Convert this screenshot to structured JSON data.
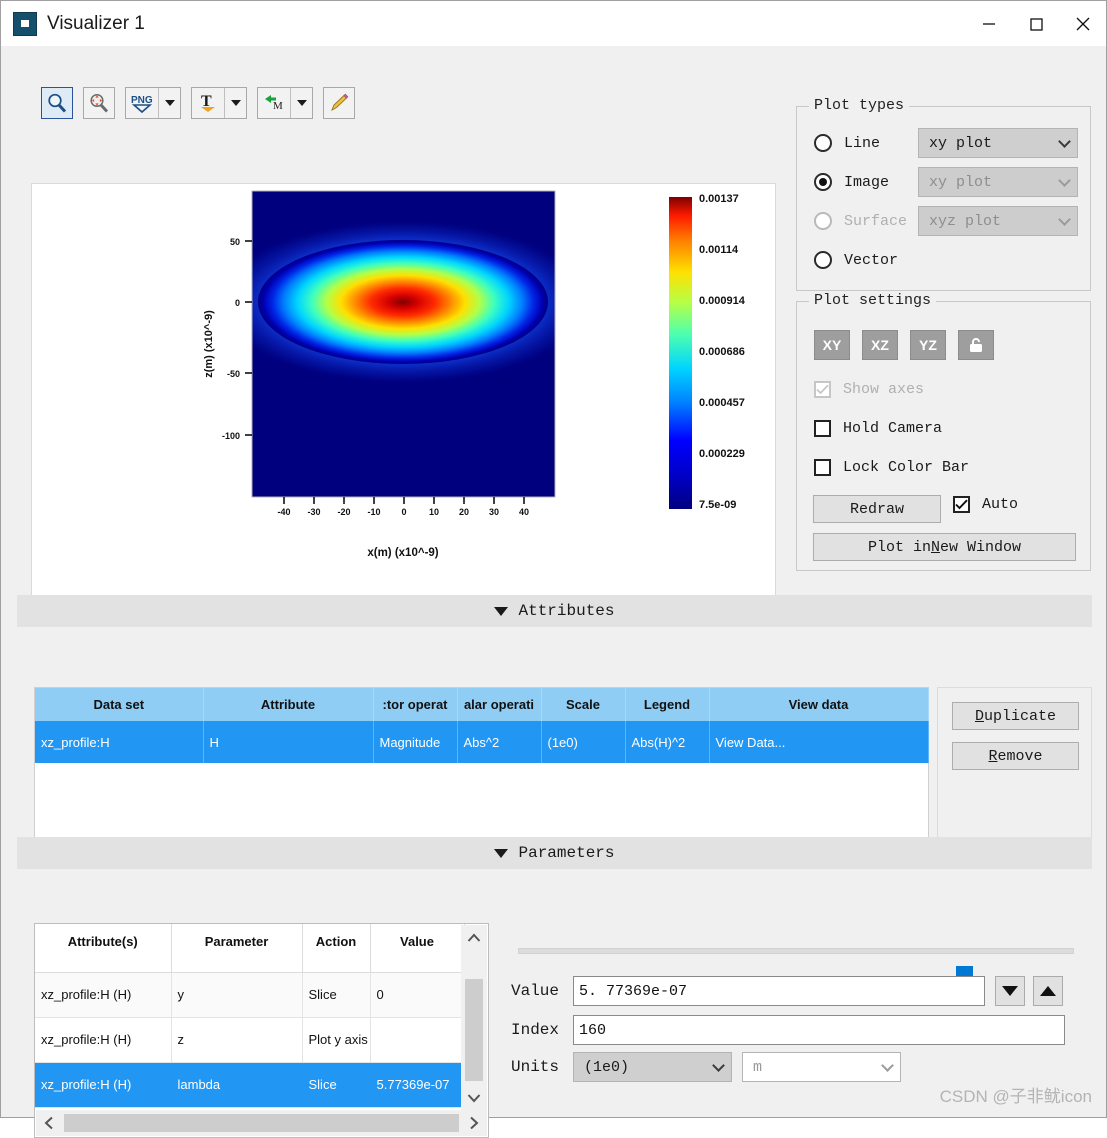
{
  "window": {
    "title": "Visualizer 1",
    "icon": "app-icon",
    "controls": {
      "minimize": "—",
      "maximize": "□",
      "close": "✕"
    }
  },
  "toolbar": {
    "buttons": [
      {
        "name": "zoom-tool",
        "icon": "magnifier-icon",
        "selected": true,
        "dropdown": false
      },
      {
        "name": "pan-tool",
        "icon": "move-magnifier-icon",
        "selected": false,
        "dropdown": false
      },
      {
        "name": "export-png",
        "icon": "png-icon",
        "selected": false,
        "dropdown": true
      },
      {
        "name": "text-tool",
        "icon": "text-T-icon",
        "selected": false,
        "dropdown": true
      },
      {
        "name": "matlab-export",
        "icon": "matlab-M-icon",
        "selected": false,
        "dropdown": true
      },
      {
        "name": "edit-tool",
        "icon": "pencil-icon",
        "selected": false,
        "dropdown": false
      }
    ]
  },
  "chart_data": {
    "type": "heatmap",
    "title": "",
    "xlabel": "x(m) (x10^-9)",
    "ylabel": "z(m) (x10^-9)",
    "xticks": [
      -40,
      -30,
      -20,
      -10,
      0,
      10,
      20,
      30,
      40
    ],
    "yticks": [
      50,
      0,
      -50,
      -100
    ],
    "xlim": [
      -47,
      48
    ],
    "ylim": [
      -120,
      78
    ],
    "colorbar": {
      "ticks": [
        "0.00137",
        "0.00114",
        "0.000914",
        "0.000686",
        "0.000457",
        "0.000229",
        "7.5e-09"
      ],
      "min": "7.5e-09",
      "max": "0.00137",
      "colormap": "jet"
    },
    "description": "Gaussian beam intensity |H|^2 in xz-plane, bright elongated lobe centered near x=0, z=-5",
    "peak": {
      "x": 0,
      "z": -5,
      "value": 0.00137
    },
    "sigma_x": 9.5,
    "sigma_z": 4.2,
    "background": 7.5e-09
  },
  "plot_types": {
    "legend": "Plot types",
    "options": [
      {
        "label": "Line",
        "selected": false,
        "enabled": true,
        "combo": "xy plot",
        "combo_enabled": true
      },
      {
        "label": "Image",
        "selected": true,
        "enabled": true,
        "combo": "xy plot",
        "combo_enabled": false
      },
      {
        "label": "Surface",
        "selected": false,
        "enabled": false,
        "combo": "xyz plot",
        "combo_enabled": false
      },
      {
        "label": "Vector",
        "selected": false,
        "enabled": true,
        "combo": null,
        "combo_enabled": false
      }
    ]
  },
  "plot_settings": {
    "legend": "Plot settings",
    "plane_buttons": [
      {
        "label": "XY",
        "name": "plane-xy-button"
      },
      {
        "label": "XZ",
        "name": "plane-xz-button"
      },
      {
        "label": "YZ",
        "name": "plane-yz-button"
      }
    ],
    "lock_button": {
      "name": "lock-aspect-button",
      "icon": "lock-icon"
    },
    "checkboxes": [
      {
        "label": "Show axes",
        "checked": true,
        "enabled": false
      },
      {
        "label": "Hold Camera",
        "checked": false,
        "enabled": true
      },
      {
        "label": "Lock Color Bar",
        "checked": false,
        "enabled": true
      }
    ],
    "redraw_button": "Redraw",
    "auto_checkbox": {
      "label": "Auto",
      "checked": true
    },
    "new_window_button_pre": "Plot in ",
    "new_window_button_mnemonic": "N",
    "new_window_button_post": "ew Window"
  },
  "attributes_section": {
    "header": "Attributes",
    "expanded": true,
    "columns": [
      "Data set",
      "Attribute",
      ":tor operat",
      "alar operati",
      "Scale",
      "Legend",
      "View data"
    ],
    "rows": [
      {
        "selected": true,
        "cells": [
          "xz_profile:H",
          "H",
          "Magnitude",
          "Abs^2",
          "(1e0)",
          "Abs(H)^2",
          "View Data..."
        ]
      }
    ],
    "duplicate_button": {
      "mnemonic": "D",
      "rest": "uplicate"
    },
    "remove_button": {
      "mnemonic": "R",
      "rest": "emove"
    }
  },
  "parameters_section": {
    "header": "Parameters",
    "expanded": true,
    "columns": [
      "Attribute(s)",
      "Parameter",
      "Action",
      "Value"
    ],
    "rows": [
      {
        "selected": false,
        "cells": [
          "xz_profile:H (H)",
          "y",
          "Slice",
          "0"
        ]
      },
      {
        "selected": false,
        "cells": [
          "xz_profile:H (H)",
          "z",
          "Plot y axis",
          ""
        ]
      },
      {
        "selected": true,
        "cells": [
          "xz_profile:H (H)",
          "lambda",
          "Slice",
          "5.77369e-07"
        ]
      }
    ],
    "detail": {
      "slider_percent": 78,
      "value_label": "Value",
      "value": "5. 77369e-07",
      "index_label": "Index",
      "index": "160",
      "units_label": "Units",
      "units_scale": "(1e0)",
      "units_unit": "m",
      "decrement_icon": "triangle-down-icon",
      "increment_icon": "triangle-up-icon"
    }
  },
  "watermark": "CSDN @子非鱿icon",
  "colors": {
    "selection_blue": "#2196f3",
    "header_blue": "#90cdf4",
    "accent_blue": "#0078d4",
    "panel_gray": "#f0f0f0"
  }
}
